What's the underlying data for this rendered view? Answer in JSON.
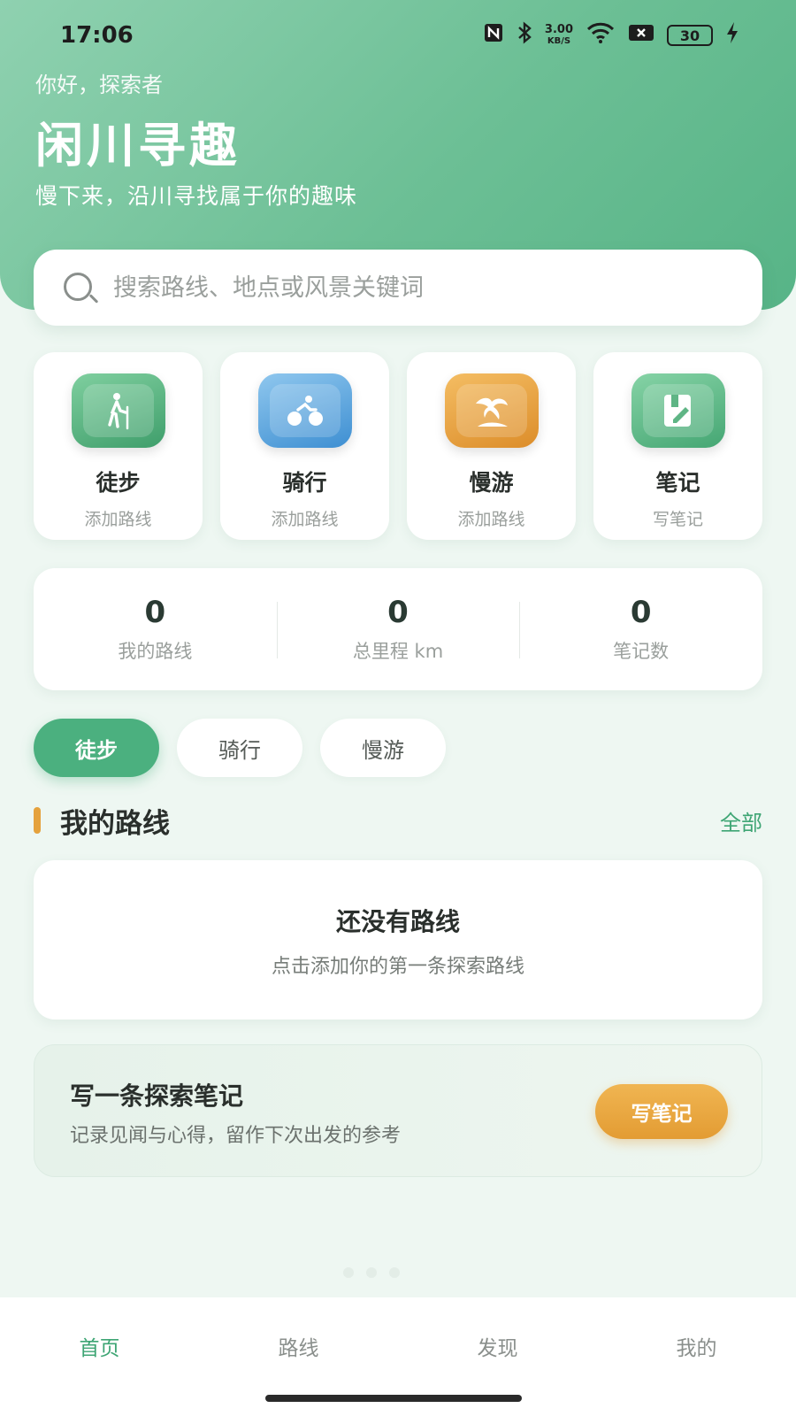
{
  "status_bar": {
    "time": "17:06",
    "net_speed_value": "3.00",
    "net_speed_unit": "KB/S",
    "battery": "30",
    "icons": [
      "nfc-icon",
      "bluetooth-icon",
      "wifi-icon",
      "sim-icon",
      "battery-icon",
      "charging-icon"
    ]
  },
  "hero": {
    "greeting": "你好，探索者",
    "title": "闲川寻趣",
    "subtitle": "慢下来，沿川寻找属于你的趣味"
  },
  "search": {
    "placeholder": "搜索路线、地点或风景关键词"
  },
  "categories": [
    {
      "label": "徒步",
      "sub": "添加路线",
      "icon": "hiking-icon"
    },
    {
      "label": "骑行",
      "sub": "添加路线",
      "icon": "cycling-icon"
    },
    {
      "label": "慢游",
      "sub": "添加路线",
      "icon": "palm-tree-icon"
    },
    {
      "label": "笔记",
      "sub": "写笔记",
      "icon": "notebook-icon"
    }
  ],
  "stats": [
    {
      "value": "0",
      "label": "我的路线"
    },
    {
      "value": "0",
      "label": "总里程 km"
    },
    {
      "value": "0",
      "label": "笔记数"
    }
  ],
  "filters": [
    {
      "label": "徒步",
      "active": true
    },
    {
      "label": "骑行",
      "active": false
    },
    {
      "label": "慢游",
      "active": false
    }
  ],
  "routes_section": {
    "title": "我的路线",
    "link": "全部",
    "empty_title": "还没有路线",
    "empty_sub": "点击添加你的第一条探索路线"
  },
  "note_card": {
    "title": "写一条探索笔记",
    "sub": "记录见闻与心得，留作下次出发的参考",
    "button": "写笔记"
  },
  "tabbar": [
    {
      "label": "首页",
      "active": true
    },
    {
      "label": "路线",
      "active": false
    },
    {
      "label": "发现",
      "active": false
    },
    {
      "label": "我的",
      "active": false
    }
  ],
  "colors": {
    "brand_green": "#4bb07f",
    "accent_orange": "#e5a23d",
    "link_green": "#3ea574"
  }
}
